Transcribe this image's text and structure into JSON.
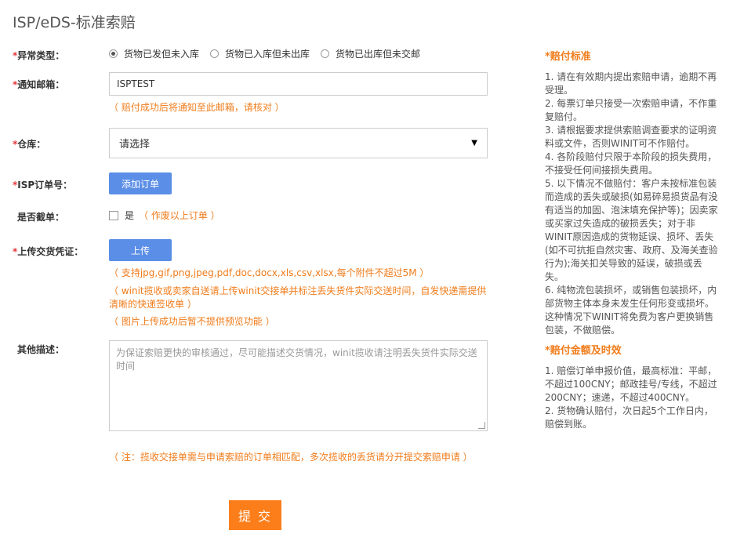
{
  "page_title": "ISP/eDS-标准索赔",
  "form": {
    "abnormal_type": {
      "label": "异常类型：",
      "required_mark": "*",
      "options": [
        "货物已发但未入库",
        "货物已入库但未出库",
        "货物已出库但未交邮"
      ],
      "selected_index": 0
    },
    "notify_email": {
      "label": "通知邮箱：",
      "required_mark": "*",
      "value": "ISPTEST",
      "hint": "（ 赔付成功后将通知至此邮箱，请核对 ）"
    },
    "warehouse": {
      "label": "仓库：",
      "required_mark": "*",
      "selected": "请选择"
    },
    "isp_order": {
      "label": "ISP订单号：",
      "required_mark": "*",
      "button": "添加订单"
    },
    "cutoff": {
      "label": "是否截单：",
      "checkbox_label": "是",
      "hint": "（ 作废以上订单 ）",
      "checked": false
    },
    "upload": {
      "label": "上传交货凭证：",
      "required_mark": "*",
      "button": "上传",
      "hint_formats": "（ 支持jpg,gif,png,jpeg,pdf,doc,docx,xls,csv,xlsx,每个附件不超过5M ）",
      "hint_proof_line1": "（ winit揽收或卖家自送请上传winit交接单并标注丢失货件实际交送时间，自发快递需提供",
      "hint_proof_line2": "清晰的快递签收单 ）",
      "hint_preview": "（ 图片上传成功后暂不提供预览功能 ）"
    },
    "description": {
      "label": "其他描述：",
      "placeholder_line1": "为保证索赔更快的审核通过，尽可能描述交货情况，winit揽收请注明丢失货件实际交送",
      "placeholder_line2": "时间"
    },
    "note": "（ 注：揽收交接单需与申请索赔的订单相匹配，多次揽收的丢货请分开提交索赔申请 ）",
    "submit": "提 交"
  },
  "sidebar": {
    "standard": {
      "title": "*赔付标准",
      "lines": [
        "1. 请在有效期内提出索赔申请，逾期不再",
        "受理。",
        "2. 每票订单只接受一次索赔申请，不作重",
        "复赔付。",
        "3. 请根据要求提供索赔调查要求的证明资",
        "料或文件，否则WINIT可不作赔付。",
        "4. 各阶段赔付只限于本阶段的损失费用，",
        "不接受任何间接损失费用。",
        "5. 以下情况不做赔付：客户未按标准包装",
        "而造成的丢失或破损(如易碎易损货品有没",
        "有适当的加固、泡沫填充保护等)；因卖家",
        "或买家过失造成的破损丢失；对于非",
        "WINIT原因造成的货物延误、损坏、丢失",
        "(如不可抗拒自然灾害、政府、及海关查验",
        "行为);海关扣关导致的延误，破损或丢",
        "失。",
        "6. 纯物流包装损坏，或销售包装损坏，内",
        "部货物主体本身未发生任何形变或损坏。",
        "这种情况下WINIT将免费为客户更换销售",
        "包装，不做赔偿。"
      ]
    },
    "amount": {
      "title": "*赔付金额及时效",
      "lines": [
        "1. 赔偿订单申报价值，最高标准：平邮，",
        "不超过100CNY；邮政挂号/专线，不超过",
        "200CNY；速递，不超过400CNY。",
        "2. 货物确认赔付，次日起5个工作日内，",
        "赔偿到账。"
      ]
    }
  }
}
